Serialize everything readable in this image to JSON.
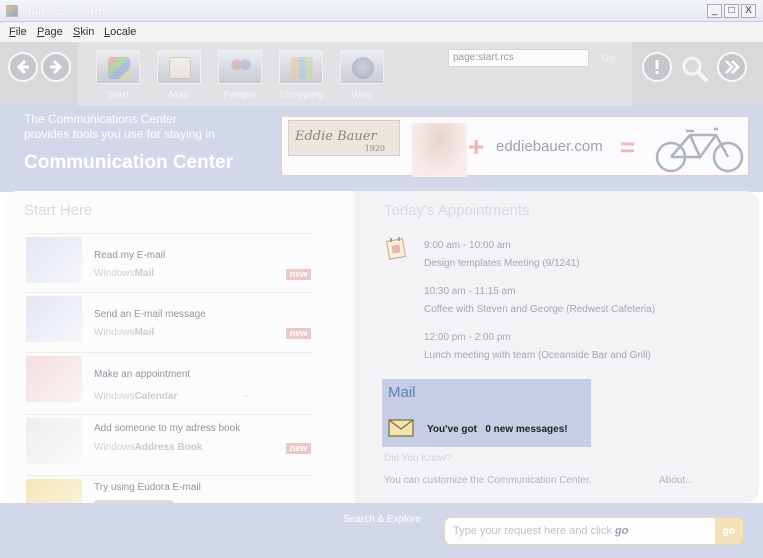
{
  "window": {
    "title": "start.rcs - RcRun",
    "controls": [
      "_",
      "□",
      "X"
    ]
  },
  "menu": [
    "File",
    "Page",
    "Skin",
    "Locale"
  ],
  "toolbar": {
    "nav_buttons": [
      "back-icon",
      "forward-icon"
    ],
    "tools": [
      {
        "label": "Start",
        "icon": "windows-start-icon"
      },
      {
        "label": "Mail",
        "icon": "mail-icon"
      },
      {
        "label": "People",
        "icon": "people-icon"
      },
      {
        "label": "Shopping",
        "icon": "shopping-icon"
      },
      {
        "label": "Web",
        "icon": "globe-icon"
      }
    ],
    "address_value": "page:start.rcs",
    "go_label": "Go",
    "right_buttons": [
      "info-icon",
      "search-icon",
      "fast-forward-icon"
    ]
  },
  "header": {
    "intro_line1": "The Communications Center",
    "intro_line2": "provides tools you use for staying in",
    "title": "Communication Center",
    "ad": {
      "logo": "Eddie Bauer",
      "logo_sub": "1920",
      "brand": "eddiebauer.com",
      "plus": "+",
      "equals": "="
    }
  },
  "start": {
    "title": "Start Here",
    "items": [
      {
        "label": "Read my E-mail",
        "app_prefix": "Windows",
        "app_name": "Mail",
        "badge": "new"
      },
      {
        "label": "Send an E-mail message",
        "app_prefix": "Windows",
        "app_name": "Mail",
        "badge": "new"
      },
      {
        "label": "Make an appointment",
        "app_prefix": "Windows",
        "app_name": "Calendar",
        "badge": "",
        "dash": "-"
      },
      {
        "label": "Add someone to my adress book",
        "app_prefix": "Windows",
        "app_name": "Address Book",
        "badge": "new"
      },
      {
        "label": "Try using Eudora E-mail",
        "app_prefix": "",
        "app_name": "",
        "badge": ""
      }
    ]
  },
  "appointments": {
    "title": "Today's Appointments",
    "items": [
      {
        "time": "9:00 am - 10:00 am",
        "desc": "Design templates Meeting (9/1241)"
      },
      {
        "time": "10:30 am - 11:15 am",
        "desc": "Coffee with Steven and George (Redwest Cafeteria)"
      },
      {
        "time": "12:00 pm - 2:00 pm",
        "desc": "Lunch meeting with team (Oceanside Bar and Grill)"
      }
    ]
  },
  "mail": {
    "title": "Mail",
    "prefix": "You've got",
    "count_text": "0 new messages!"
  },
  "did_you_know": {
    "title": "Did You Know?",
    "text": "You can   customize the Communication Center.",
    "about": "About..."
  },
  "search": {
    "label": "Search & Explore",
    "placeholder_text": "Type your request here and click ",
    "placeholder_em": "go",
    "go_label": "go"
  },
  "colors": {
    "band": "#d2d8ea",
    "toolbar": "#d9d9dc",
    "mail_box": "#c6cee6",
    "new_badge": "#ecc7c7"
  }
}
